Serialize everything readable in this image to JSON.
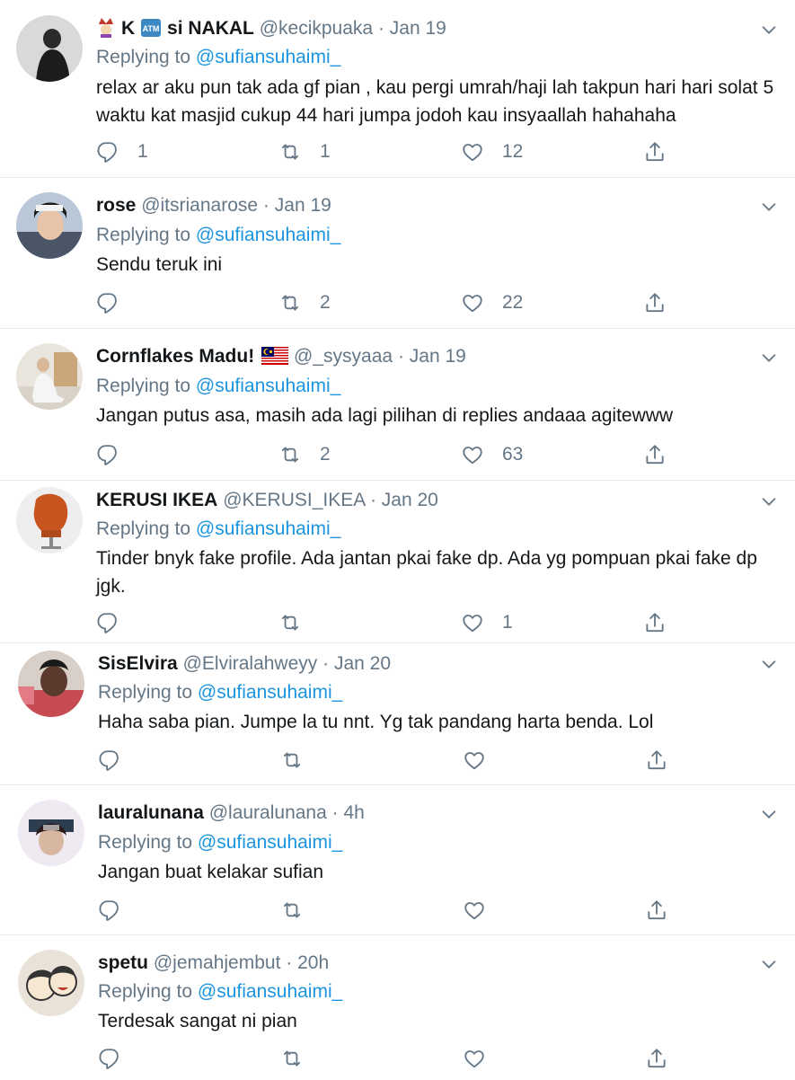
{
  "replying_label": "Replying to",
  "tweets": [
    {
      "name_prefix": "K",
      "name_suffix": "si NAKAL",
      "handle": "@kecikpuaka",
      "time": "Jan 19",
      "mention": "@sufiansuhaimi_",
      "text": "relax ar aku pun tak ada gf pian , kau pergi umrah/haji lah takpun hari hari solat 5 waktu kat masjid cukup 44 hari jumpa jodoh kau insyaallah hahahaha",
      "replies": "1",
      "retweets": "1",
      "likes": "12"
    },
    {
      "name": "rose",
      "handle": "@itsrianarose",
      "time": "Jan 19",
      "mention": "@sufiansuhaimi_",
      "text": "Sendu teruk ini",
      "replies": "",
      "retweets": "2",
      "likes": "22"
    },
    {
      "name": "Cornflakes Madu!",
      "handle": "@_sysyaaa",
      "time": "Jan 19",
      "mention": "@sufiansuhaimi_",
      "text": "Jangan putus asa, masih ada lagi pilihan di replies andaaa agitewww",
      "replies": "",
      "retweets": "2",
      "likes": "63"
    },
    {
      "name": "KERUSI IKEA",
      "handle": "@KERUSI_IKEA",
      "time": "Jan 20",
      "mention": "@sufiansuhaimi_",
      "text": "Tinder bnyk fake profile. Ada jantan pkai fake dp. Ada yg pompuan pkai fake dp jgk.",
      "replies": "",
      "retweets": "",
      "likes": "1"
    },
    {
      "name": "SisElvira",
      "handle": "@Elviralahweyy",
      "time": "Jan 20",
      "mention": "@sufiansuhaimi_",
      "text": "Haha saba pian. Jumpe la tu nnt. Yg tak pandang harta benda. Lol",
      "replies": "",
      "retweets": "",
      "likes": ""
    },
    {
      "name": "lauralunana",
      "handle": "@lauralunana",
      "time": "4h",
      "mention": "@sufiansuhaimi_",
      "text": "Jangan buat kelakar sufian",
      "replies": "",
      "retweets": "",
      "likes": ""
    },
    {
      "name": "spetu",
      "handle": "@jemahjembut",
      "time": "20h",
      "mention": "@sufiansuhaimi_",
      "text": "Terdesak sangat ni pian",
      "replies": "",
      "retweets": "",
      "likes": ""
    }
  ],
  "colors": {
    "text": "#14171a",
    "muted": "#657786",
    "link": "#1b95e0",
    "divider": "#e6ecf0"
  },
  "icons": [
    "reply-icon",
    "retweet-icon",
    "like-icon",
    "share-icon",
    "chevron-down-icon"
  ]
}
